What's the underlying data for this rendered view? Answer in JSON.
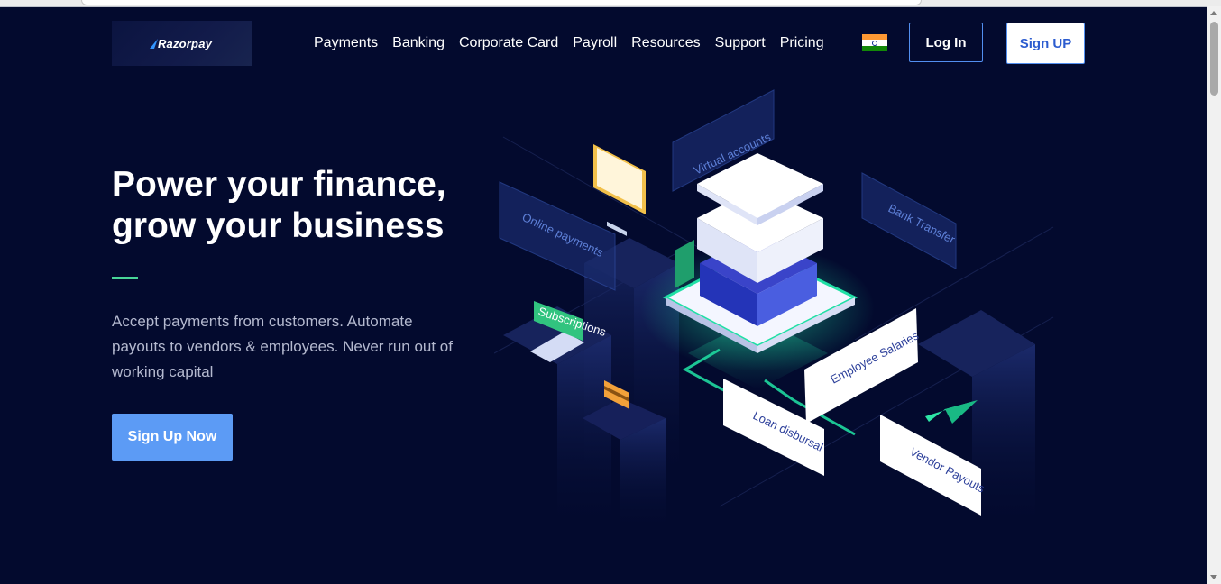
{
  "brand": {
    "name": "Razorpay"
  },
  "nav": {
    "items": [
      {
        "label": "Payments"
      },
      {
        "label": "Banking"
      },
      {
        "label": "Corporate Card"
      },
      {
        "label": "Payroll"
      },
      {
        "label": "Resources"
      },
      {
        "label": "Support"
      },
      {
        "label": "Pricing"
      }
    ],
    "login_label": "Log In",
    "signup_label": "Sign UP"
  },
  "hero": {
    "title_line1": "Power your finance,",
    "title_line2": "grow your business",
    "description": "Accept payments from customers. Automate payouts to vendors & employees. Never run out of working capital",
    "cta_label": "Sign Up Now"
  },
  "illustration": {
    "labels": {
      "virtual_accounts": "Virtual accounts",
      "online_payments": "Online payments",
      "bank_transfer": "Bank Transfer",
      "subscriptions": "Subscriptions",
      "employee_salaries": "Employee Salaries",
      "loan_disbursal": "Loan disbursal",
      "vendor_payouts": "Vendor Payouts"
    }
  },
  "icons": {
    "flag": "india-flag-icon",
    "logo_mark": "razorpay-logo-icon"
  },
  "colors": {
    "background": "#030a2e",
    "accent_green": "#48d597",
    "primary_blue": "#5c9bf5",
    "signup_text": "#2c5ccf"
  }
}
